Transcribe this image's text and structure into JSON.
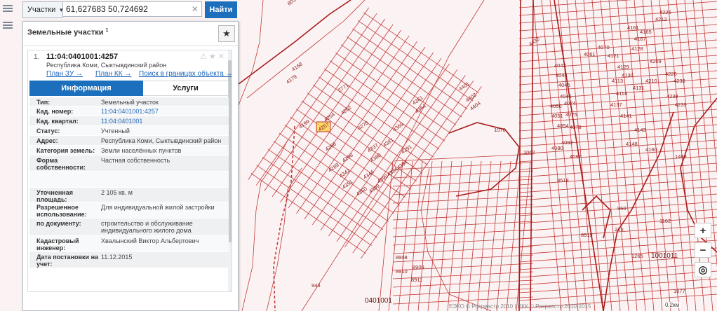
{
  "search": {
    "layer_label": "Участки",
    "query": "61,627683 50,724692",
    "button_label": "Найти"
  },
  "panel": {
    "title": "Земельные участки",
    "title_count": "1",
    "result": {
      "index": "1.",
      "cadastral_number": "11:04:0401001:4257",
      "address": "Республика Коми, Сыктывдинский район",
      "links": [
        "План ЗУ →",
        "План КК →",
        "Поиск в границах объекта →"
      ],
      "tabs": [
        "Информация",
        "Услуги"
      ],
      "rows": [
        {
          "key": "Тип:",
          "value": "Земельный участок"
        },
        {
          "key": "Кад. номер:",
          "value": "11:04:0401001:4257"
        },
        {
          "key": "Кад. квартал:",
          "value": "11:04:0401001"
        },
        {
          "key": "Статус:",
          "value": "Учтенный"
        },
        {
          "key": "Адрес:",
          "value": "Республика Коми, Сыктывдинский район"
        },
        {
          "key": "Категория земель:",
          "value": "Земли населённых пунктов"
        },
        {
          "key": "Форма собственности:",
          "value": "Частная собственность"
        },
        {
          "key": "",
          "value": ""
        },
        {
          "key": "Уточненная площадь:",
          "value": "2 105 кв. м"
        },
        {
          "key": "Разрешенное использование:",
          "value": "Для индивидуальной жилой застройки"
        },
        {
          "key": "по документу:",
          "value": "строительство и обслуживание индивидуального жилого дома"
        },
        {
          "key": "Кадастровый инженер:",
          "value": "Хвалынский Виктор Альбертович"
        },
        {
          "key": "Дата постановки на учет:",
          "value": "11.12.2015"
        }
      ]
    }
  },
  "map": {
    "highlight_parcel": "4257",
    "kvartal_labels": [
      "0401001",
      "1001011"
    ],
    "attribution": "ЕЭКО © Росреестр 2010 | ПКК © Росреестр 2010-2015",
    "scale": "0,2км",
    "parcel_labels": [
      "8036",
      "2771",
      "4168",
      "4179",
      "4199",
      "4254",
      "4257",
      "4262",
      "4266",
      "4270",
      "4289",
      "4298",
      "4337",
      "4342",
      "4344",
      "4351",
      "4360",
      "4361",
      "4364",
      "4369",
      "4380",
      "4381",
      "4384",
      "4390",
      "4391",
      "4394",
      "4399",
      "4401",
      "4402",
      "4404",
      "4432",
      "4043",
      "4044",
      "4045",
      "4046",
      "4050",
      "4051",
      "4054",
      "4061",
      "4070",
      "4074",
      "4075",
      "4078",
      "4080",
      "4092",
      "4097",
      "4113",
      "4114",
      "4121",
      "4128",
      "4129",
      "4130",
      "4131",
      "4137",
      "4141",
      "4143",
      "4148",
      "4160",
      "4161",
      "4165",
      "4167",
      "4209",
      "4210",
      "4212",
      "4225",
      "4226",
      "4230",
      "4238",
      "4239",
      "1076",
      "1062",
      "8518",
      "8519",
      "8910",
      "8911",
      "8908",
      "8909",
      "943",
      "960",
      "215",
      "1162",
      "1265",
      "1489",
      "1077"
    ],
    "controls": [
      "+",
      "−",
      "◎"
    ]
  },
  "colors": {
    "accent": "#1c6fbc",
    "parcel_line": "#c0392b",
    "highlight": "#ffd54a"
  },
  "icons": {
    "layers": "layers-icon",
    "menu": "menu-icon",
    "star": "star-icon",
    "clear": "close-icon"
  }
}
